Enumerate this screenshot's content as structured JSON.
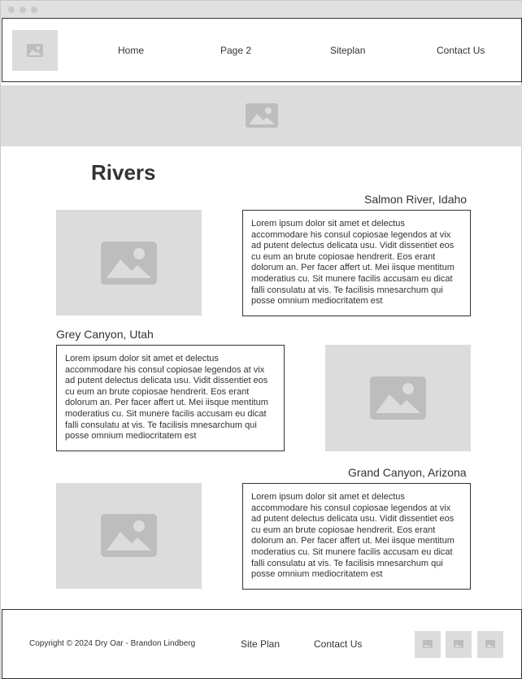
{
  "nav": {
    "links": [
      "Home",
      "Page 2",
      "Siteplan",
      "Contact Us"
    ]
  },
  "main": {
    "title": "Rivers",
    "rivers": [
      {
        "title": "Salmon River, Idaho",
        "text": "Lorem ipsum dolor sit amet et delectus accommodare his consul copiosae legendos at vix ad putent delectus delicata usu. Vidit dissentiet eos cu eum an brute copiosae hendrerit. Eos erant dolorum an. Per facer affert ut. Mei iisque mentitum moderatius cu. Sit munere facilis accusam eu dicat falli consulatu at vis. Te facilisis mnesarchum qui posse omnium mediocritatem est"
      },
      {
        "title": "Grey Canyon, Utah",
        "text": "Lorem ipsum dolor sit amet et delectus accommodare his consul copiosae legendos at vix ad putent delectus delicata usu. Vidit dissentiet eos cu eum an brute copiosae hendrerit. Eos erant dolorum an. Per facer affert ut. Mei iisque mentitum moderatius cu. Sit munere facilis accusam eu dicat falli consulatu at vis. Te facilisis mnesarchum qui posse omnium mediocritatem est"
      },
      {
        "title": "Grand Canyon, Arizona",
        "text": "Lorem ipsum dolor sit amet et delectus accommodare his consul copiosae legendos at vix ad putent delectus delicata usu. Vidit dissentiet eos cu eum an brute copiosae hendrerit. Eos erant dolorum an. Per facer affert ut. Mei iisque mentitum moderatius cu. Sit munere facilis accusam eu dicat falli consulatu at vis. Te facilisis mnesarchum qui posse omnium mediocritatem est"
      }
    ]
  },
  "footer": {
    "copyright": "Copyright © 2024 Dry Oar - Brandon Lindberg",
    "links": [
      "Site Plan",
      "Contact Us"
    ],
    "social_icons": [
      "image-icon",
      "image-icon",
      "image-icon"
    ]
  },
  "colors": {
    "placeholder": "#dcdcdc",
    "placeholder_icon": "#bdbdbd",
    "text": "#333333",
    "border": "#333333"
  }
}
